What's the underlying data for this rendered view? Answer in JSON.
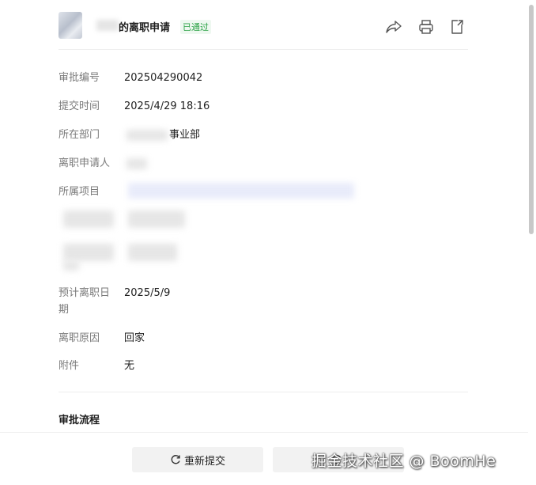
{
  "header": {
    "title": "的离职申请",
    "status": "已通过",
    "icons": [
      "share-icon",
      "print-icon",
      "export-icon"
    ]
  },
  "fields": [
    {
      "label": "审批编号",
      "value": "202504290042"
    },
    {
      "label": "提交时间",
      "value": "2025/4/29 18:16"
    },
    {
      "label": "所在部门",
      "value": "事业部"
    },
    {
      "label": "离职申请人",
      "value": ""
    },
    {
      "label": "所属项目",
      "value": ""
    },
    {
      "label": "预计离职日期",
      "value": "2025/5/9"
    },
    {
      "label": "离职原因",
      "value": "回家"
    },
    {
      "label": "附件",
      "value": "无"
    }
  ],
  "section": {
    "title": "审批流程"
  },
  "footer": {
    "resubmit_label": "重新提交",
    "second_label": ""
  },
  "watermark": "掘金技术社区 @ BoomHe",
  "colors": {
    "status_green": "#2ba245",
    "label_gray": "#7a7a7a",
    "button_bg": "#f2f2f2"
  }
}
